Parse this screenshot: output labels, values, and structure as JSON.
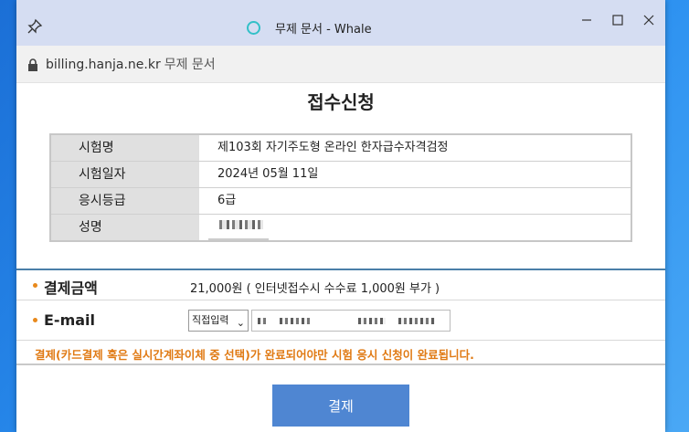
{
  "window": {
    "title": "무제 문서 - Whale",
    "controls": [
      "minimize-icon",
      "maximize-icon",
      "close-icon"
    ],
    "pin_icon": "pin-icon"
  },
  "address": {
    "domain": "billing.hanja.ne.kr",
    "page_title": "무제 문서",
    "icon": "lock-icon"
  },
  "page": {
    "heading": "접수신청",
    "info_rows": [
      {
        "label": "시험명",
        "value": "제103회 자기주도형 온라인 한자급수자격검정"
      },
      {
        "label": "시험일자",
        "value": "2024년 05월 11일"
      },
      {
        "label": "응시등급",
        "value": "6급"
      },
      {
        "label": "성명",
        "value": ""
      }
    ],
    "payment": {
      "amount_label": "결제금액",
      "amount_value": "21,000원 ( 인터넷접수시 수수료 1,000원 부가 )",
      "email_label": "E-mail",
      "email_select": "직접입력",
      "notice": "결제(카드결제 혹은 실시간계좌이체 중 선택)가 완료되어야만 시험 응시 신청이 완료됩니다."
    },
    "pay_button": "결제"
  },
  "colors": {
    "titlebar": "#d5ddf2",
    "accent_orange": "#e07a14",
    "button_blue": "#4f86d2",
    "label_bg": "#e0e0e0"
  }
}
